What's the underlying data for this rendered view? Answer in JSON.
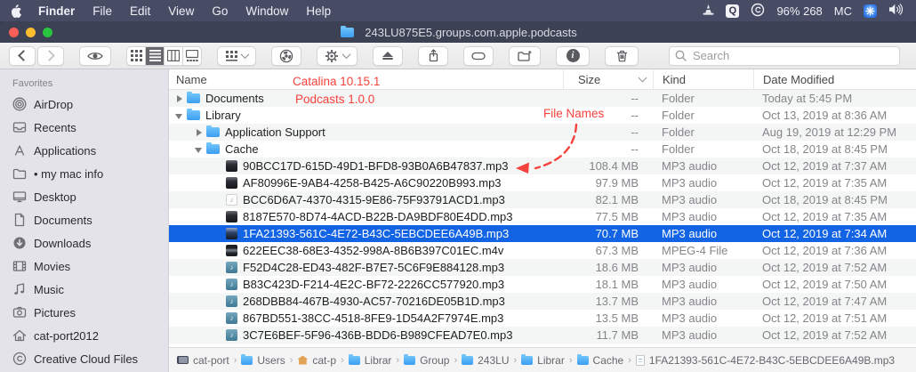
{
  "menu_bar": {
    "items": [
      "Finder",
      "File",
      "Edit",
      "View",
      "Go",
      "Window",
      "Help"
    ],
    "status": {
      "battery": "96% 268",
      "account": "MC",
      "icons": [
        "vlc-cone-icon",
        "q-app-icon",
        "creative-cloud-icon",
        "settings-icon",
        "volume-icon"
      ]
    }
  },
  "window": {
    "title": "243LU875E5.groups.com.apple.podcasts"
  },
  "toolbar": {
    "search_placeholder": "Search",
    "buttons": [
      "back",
      "forward",
      "quick-look",
      "icon-view",
      "list-view",
      "column-view",
      "gallery-view",
      "group-by",
      "burn",
      "action",
      "eject",
      "share",
      "tag",
      "new-folder",
      "get-info",
      "delete"
    ]
  },
  "sidebar": {
    "section": "Favorites",
    "items": [
      {
        "label": "AirDrop",
        "icon": "airdrop"
      },
      {
        "label": "Recents",
        "icon": "recents"
      },
      {
        "label": "Applications",
        "icon": "applications"
      },
      {
        "label": "• my mac info",
        "icon": "folder"
      },
      {
        "label": "Desktop",
        "icon": "desktop"
      },
      {
        "label": "Documents",
        "icon": "document"
      },
      {
        "label": "Downloads",
        "icon": "downloads"
      },
      {
        "label": "Movies",
        "icon": "movies"
      },
      {
        "label": "Music",
        "icon": "music"
      },
      {
        "label": "Pictures",
        "icon": "pictures"
      },
      {
        "label": "cat-port2012",
        "icon": "home"
      },
      {
        "label": "Creative Cloud Files",
        "icon": "creative-cloud"
      }
    ]
  },
  "annotations": {
    "line1": "Catalina 10.15.1",
    "line2": "Podcasts 1.0.0",
    "arrow_label": "File Names",
    "color": "#f5423d"
  },
  "list": {
    "columns": [
      "Name",
      "Size",
      "Kind",
      "Date Modified"
    ],
    "sorted_by": "Size",
    "rows": [
      {
        "name": "Documents",
        "indent": 0,
        "disclosure": "right",
        "icon": "folder",
        "size": "--",
        "kind": "Folder",
        "date": "Today at 5:45 PM"
      },
      {
        "name": "Library",
        "indent": 0,
        "disclosure": "down",
        "icon": "folder",
        "size": "--",
        "kind": "Folder",
        "date": "Oct 13, 2019 at 8:36 AM"
      },
      {
        "name": "Application Support",
        "indent": 1,
        "disclosure": "right",
        "icon": "folder",
        "size": "--",
        "kind": "Folder",
        "date": "Aug 19, 2019 at 12:29 PM"
      },
      {
        "name": "Cache",
        "indent": 1,
        "disclosure": "down",
        "icon": "folder",
        "size": "--",
        "kind": "Folder",
        "date": "Oct 18, 2019 at 8:45 PM"
      },
      {
        "name": "90BCC17D-615D-49D1-BFD8-93B0A6B47837.mp3",
        "indent": 2,
        "disclosure": "none",
        "icon": "album",
        "size": "108.4 MB",
        "kind": "MP3 audio",
        "date": "Oct 12, 2019 at 7:37 AM"
      },
      {
        "name": "AF80996E-9AB4-4258-B425-A6C90220B993.mp3",
        "indent": 2,
        "disclosure": "none",
        "icon": "album",
        "size": "97.9 MB",
        "kind": "MP3 audio",
        "date": "Oct 12, 2019 at 7:35 AM"
      },
      {
        "name": "BCC6D6A7-4370-4315-9E86-75F93791ACD1.mp3",
        "indent": 2,
        "disclosure": "none",
        "icon": "audio-plain",
        "size": "82.1 MB",
        "kind": "MP3 audio",
        "date": "Oct 18, 2019 at 8:45 PM"
      },
      {
        "name": "8187E570-8D74-4ACD-B22B-DA9BDF80E4DD.mp3",
        "indent": 2,
        "disclosure": "none",
        "icon": "album",
        "size": "77.5 MB",
        "kind": "MP3 audio",
        "date": "Oct 12, 2019 at 7:35 AM"
      },
      {
        "name": "1FA21393-561C-4E72-B43C-5EBCDEE6A49B.mp3",
        "indent": 2,
        "disclosure": "none",
        "icon": "album",
        "size": "70.7 MB",
        "kind": "MP3 audio",
        "date": "Oct 12, 2019 at 7:34 AM",
        "selected": true
      },
      {
        "name": "622EEC38-68E3-4352-998A-8B6B397C01EC.m4v",
        "indent": 2,
        "disclosure": "none",
        "icon": "video",
        "size": "67.3 MB",
        "kind": "MPEG-4 File",
        "date": "Oct 12, 2019 at 7:36 AM"
      },
      {
        "name": "F52D4C28-ED43-482F-B7E7-5C6F9E884128.mp3",
        "indent": 2,
        "disclosure": "none",
        "icon": "audio-teal",
        "size": "18.6 MB",
        "kind": "MP3 audio",
        "date": "Oct 12, 2019 at 7:52 AM"
      },
      {
        "name": "B83C423D-F214-4E2C-BF72-2226CC577920.mp3",
        "indent": 2,
        "disclosure": "none",
        "icon": "audio-teal",
        "size": "18.1 MB",
        "kind": "MP3 audio",
        "date": "Oct 12, 2019 at 7:50 AM"
      },
      {
        "name": "268DBB84-467B-4930-AC57-70216DE05B1D.mp3",
        "indent": 2,
        "disclosure": "none",
        "icon": "audio-teal",
        "size": "13.7 MB",
        "kind": "MP3 audio",
        "date": "Oct 12, 2019 at 7:47 AM"
      },
      {
        "name": "867BD551-38CC-4518-8FE9-1D54A2F7974E.mp3",
        "indent": 2,
        "disclosure": "none",
        "icon": "audio-teal",
        "size": "13.5 MB",
        "kind": "MP3 audio",
        "date": "Oct 12, 2019 at 7:51 AM"
      },
      {
        "name": "3C7E6BEF-5F96-436B-BDD6-B989CFEAD7E0.mp3",
        "indent": 2,
        "disclosure": "none",
        "icon": "audio-teal",
        "size": "11.7 MB",
        "kind": "MP3 audio",
        "date": "Oct 12, 2019 at 7:52 AM"
      }
    ]
  },
  "path_bar": {
    "items": [
      {
        "label": "cat-port",
        "icon": "computer"
      },
      {
        "label": "Users",
        "icon": "folder-users"
      },
      {
        "label": "cat-p",
        "icon": "home"
      },
      {
        "label": "Librar",
        "icon": "folder"
      },
      {
        "label": "Group",
        "icon": "folder"
      },
      {
        "label": "243LU",
        "icon": "folder"
      },
      {
        "label": "Librar",
        "icon": "folder"
      },
      {
        "label": "Cache",
        "icon": "folder"
      },
      {
        "label": "1FA21393-561C-4E72-B43C-5EBCDEE6A49B.mp3",
        "icon": "file"
      }
    ]
  },
  "colors": {
    "selection": "#1264e4",
    "folder_blue": "#51aef7",
    "annotation_red": "#f5423d"
  }
}
